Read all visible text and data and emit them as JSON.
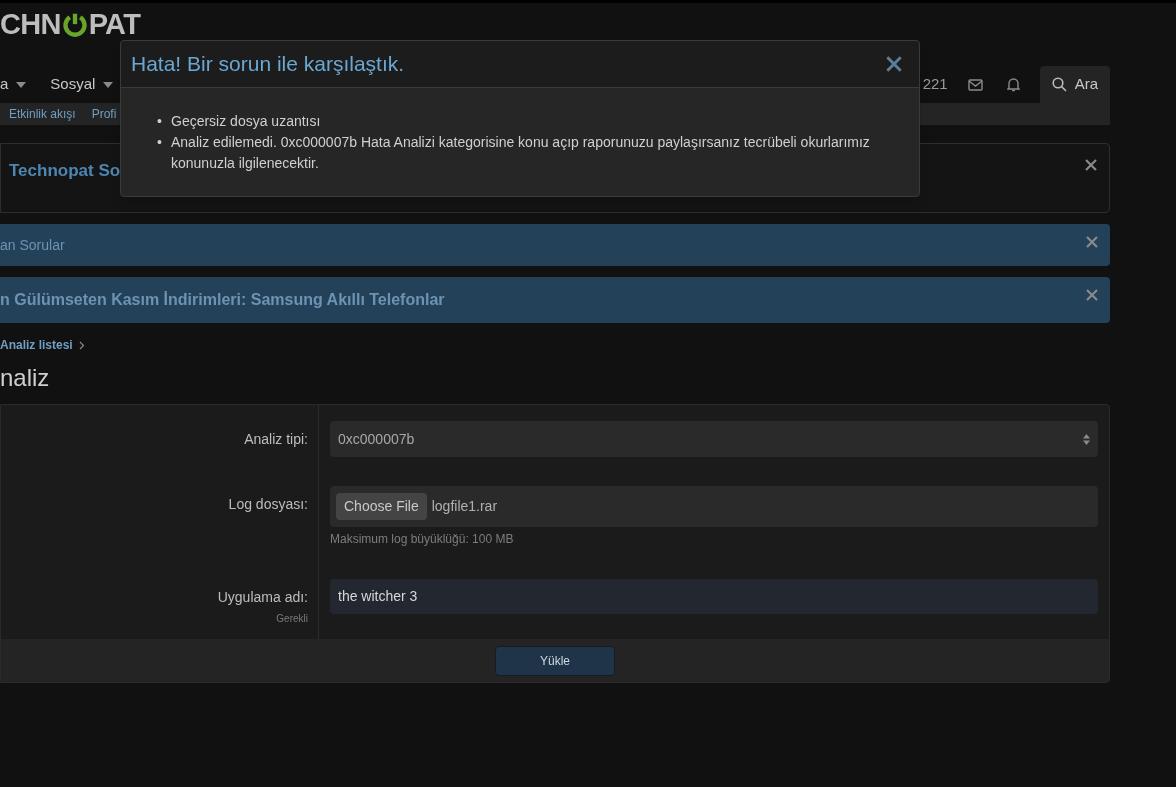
{
  "header": {
    "logo": {
      "before": "CHN",
      "after": "PAT"
    },
    "nav": [
      {
        "label": "a",
        "dropdown": true
      },
      {
        "label": "Sosyal",
        "dropdown": true
      }
    ],
    "user": {
      "count": "221"
    },
    "search_tab": {
      "label": "Ara",
      "selected": true
    },
    "subnav": [
      "Etkinlik akışı",
      "Profi"
    ]
  },
  "notices": [
    {
      "kind": "card",
      "text": "Technopat So"
    },
    {
      "kind": "bar",
      "text": "an Sorular",
      "bold": false
    },
    {
      "kind": "bar",
      "text": "n Gülümseten Kasım İndirimleri: Samsung Akıllı Telefonlar",
      "bold": true
    }
  ],
  "breadcrumb": [
    "Analiz listesi"
  ],
  "page_title": "naliz",
  "form": {
    "rows": [
      {
        "kind": "select",
        "label": "Analiz tipi:",
        "value": "0xc000007b"
      },
      {
        "kind": "file",
        "label": "Log dosyası:",
        "button": "Choose File",
        "value": "logfile1.rar",
        "hint": "Maksimum log büyüklüğü: 100 MB"
      },
      {
        "kind": "text",
        "label": "Uygulama adı:",
        "sublabel": "Gerekli",
        "value": "the witcher 3"
      }
    ],
    "submit": "Yükle"
  },
  "modal": {
    "title": "Hata! Bir sorun ile karşılaştık.",
    "errors": [
      {
        "bullet": "•",
        "text": "Geçersiz dosya uzantısı"
      },
      {
        "bullet": "•",
        "text": "Analiz edilemedi. 0xc000007b Hata Analizi kategorisine konu açıp raporunuzu paylaşırsanız tecrübeli okurlarımız konunuzla ilgilenecektir."
      }
    ]
  }
}
